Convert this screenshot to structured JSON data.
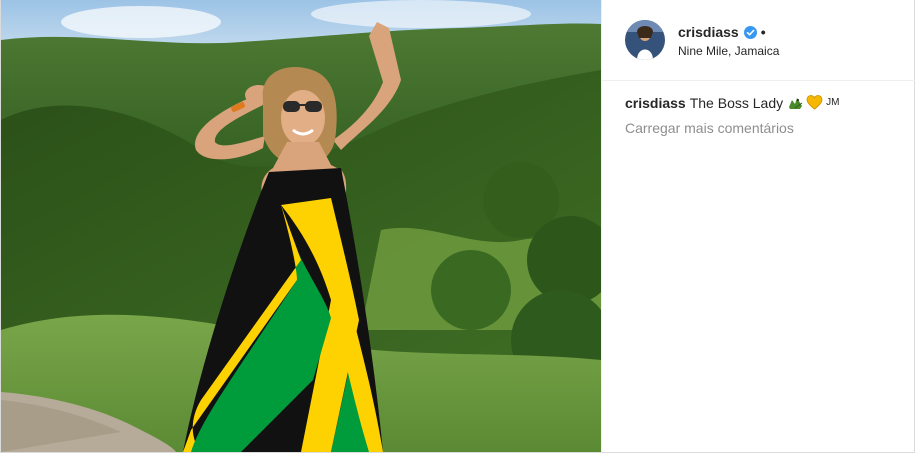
{
  "post": {
    "username": "crisdiass",
    "separator": "•",
    "location": "Nine Mile, Jamaica",
    "caption": {
      "username": "crisdiass",
      "text": "The Boss Lady",
      "emoji": [
        "crocodile-emoji",
        "yellow-heart-emoji"
      ],
      "trailing": "JM"
    },
    "load_more_label": "Carregar mais comentários"
  },
  "colors": {
    "text": "#262626",
    "muted": "#8e8e8e",
    "verified": "#3897f0",
    "jamaica_green": "#009b3a",
    "jamaica_yellow": "#fed100",
    "jamaica_black": "#000000"
  }
}
